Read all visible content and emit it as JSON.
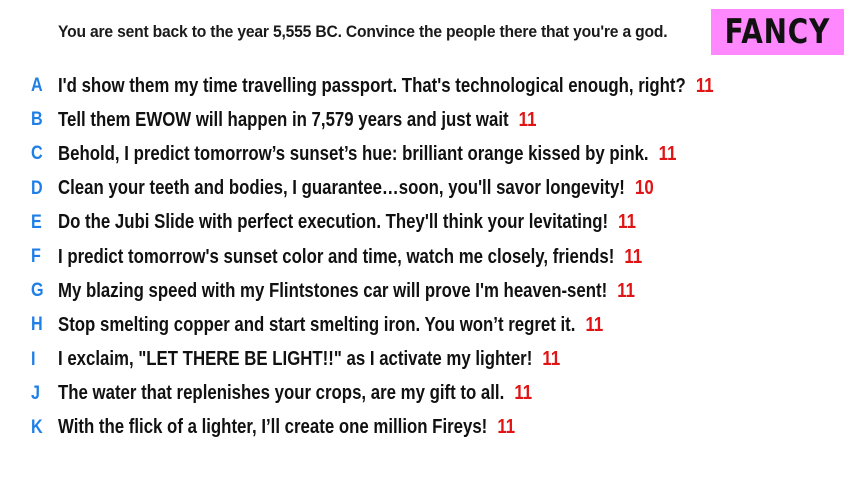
{
  "prompt": "You are sent back to the year 5,555 BC. Convince the people there that you're a god.",
  "badge": {
    "label": "FANCY",
    "color": "#ff88ff"
  },
  "colors": {
    "letter": "#1f7fe6",
    "score": "#e01414",
    "text": "#111111"
  },
  "entries": [
    {
      "letter": "A",
      "text": "I'd show them my time travelling passport. That's technological enough, right?",
      "score": "11"
    },
    {
      "letter": "B",
      "text": "Tell them EWOW will happen in 7,579 years and just wait",
      "score": "11"
    },
    {
      "letter": "C",
      "text": "Behold, I predict tomorrow’s sunset’s hue: brilliant orange kissed by pink.",
      "score": "11"
    },
    {
      "letter": "D",
      "text": "Clean your teeth and bodies, I guarantee…soon, you'll savor longevity!",
      "score": "10"
    },
    {
      "letter": "E",
      "text": "Do the Jubi Slide with perfect execution. They'll think your levitating!",
      "score": "11"
    },
    {
      "letter": "F",
      "text": "I predict tomorrow's sunset color and time, watch me closely, friends!",
      "score": "11"
    },
    {
      "letter": "G",
      "text": "My blazing speed with my Flintstones car will prove I'm heaven-sent!",
      "score": "11"
    },
    {
      "letter": "H",
      "text": "Stop smelting copper and start smelting iron. You won’t regret it.",
      "score": "11"
    },
    {
      "letter": "I",
      "text": "I exclaim, \"LET THERE BE LIGHT!!\" as I activate my lighter!",
      "score": "11"
    },
    {
      "letter": "J",
      "text": "The water that replenishes your crops, are my gift to all.",
      "score": "11"
    },
    {
      "letter": "K",
      "text": "With the flick of a lighter, I’ll create one million Fireys!",
      "score": "11"
    }
  ]
}
